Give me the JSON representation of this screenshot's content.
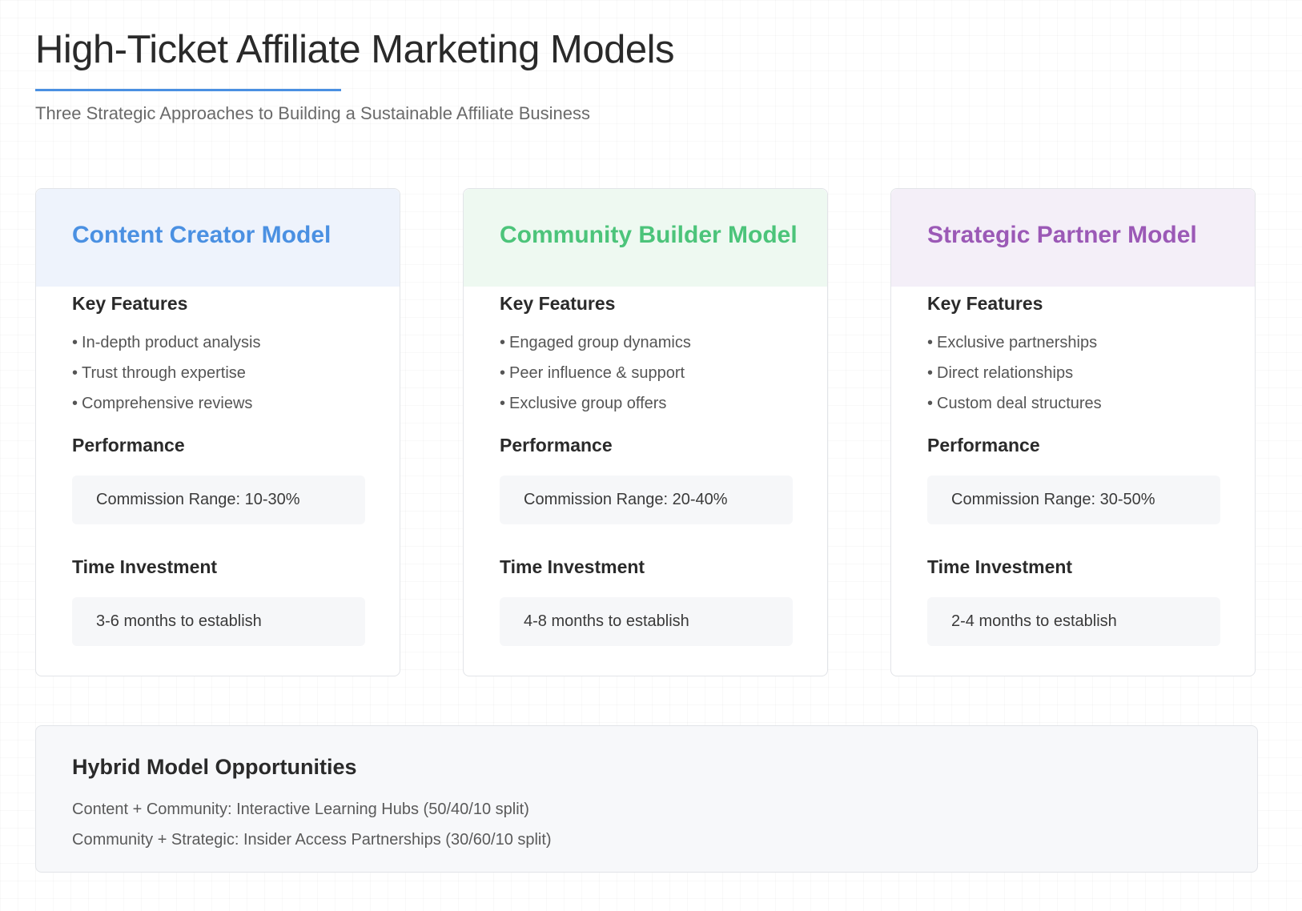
{
  "header": {
    "title": "High-Ticket Affiliate Marketing Models",
    "subtitle": "Three Strategic Approaches to Building a Sustainable Affiliate Business"
  },
  "colors": {
    "accent": "#4a90e2",
    "content": "#4a90e2",
    "community": "#4cc47a",
    "strategic": "#9b59b6"
  },
  "models": [
    {
      "title": "Content Creator Model",
      "features_heading": "Key Features",
      "features": [
        "In-depth product analysis",
        "Trust through expertise",
        "Comprehensive reviews"
      ],
      "performance_heading": "Performance",
      "commission": "Commission Range: 10-30%",
      "time_heading": "Time Investment",
      "time": "3-6 months to establish"
    },
    {
      "title": "Community Builder Model",
      "features_heading": "Key Features",
      "features": [
        "Engaged group dynamics",
        "Peer influence & support",
        "Exclusive group offers"
      ],
      "performance_heading": "Performance",
      "commission": "Commission Range: 20-40%",
      "time_heading": "Time Investment",
      "time": "4-8 months to establish"
    },
    {
      "title": "Strategic Partner Model",
      "features_heading": "Key Features",
      "features": [
        "Exclusive partnerships",
        "Direct relationships",
        "Custom deal structures"
      ],
      "performance_heading": "Performance",
      "commission": "Commission Range: 30-50%",
      "time_heading": "Time Investment",
      "time": "2-4 months to establish"
    }
  ],
  "hybrid": {
    "title": "Hybrid Model Opportunities",
    "items": [
      "Content + Community: Interactive Learning Hubs (50/40/10 split)",
      "Community + Strategic: Insider Access Partnerships (30/60/10 split)"
    ]
  }
}
